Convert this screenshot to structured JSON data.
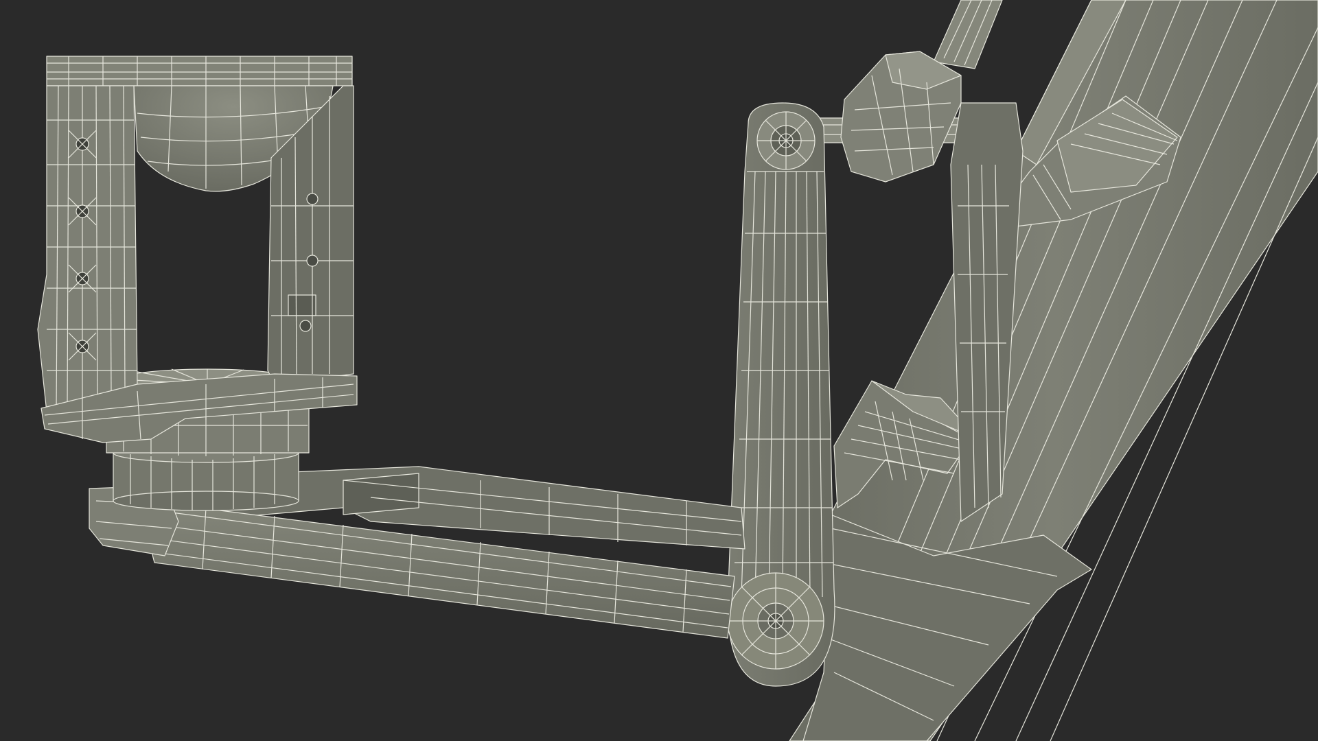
{
  "scene": {
    "background_color": "#2a2a2a",
    "surface_color": "#75776c",
    "surface_light": "#8a8c80",
    "surface_dark": "#5d5f55",
    "wire_color": "#e6e6dc",
    "subject": "wireframe-3d-model",
    "parts": [
      {
        "name": "camera-head-frame"
      },
      {
        "name": "pan-base"
      },
      {
        "name": "bottom-arm"
      },
      {
        "name": "upright-arm"
      },
      {
        "name": "tilt-joint"
      },
      {
        "name": "crane-boom"
      }
    ]
  }
}
